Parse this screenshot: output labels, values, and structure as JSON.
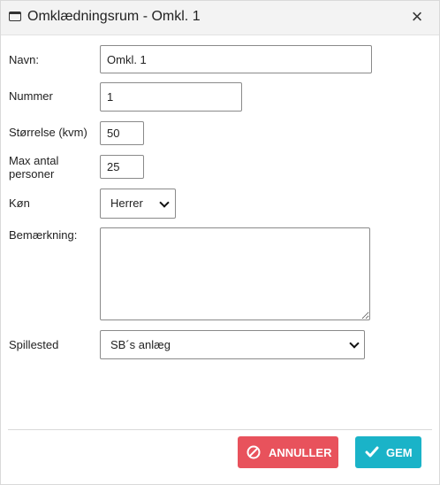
{
  "dialog": {
    "title": "Omklædningsrum - Omkl. 1",
    "close_glyph": "×",
    "window_icon": "window-icon"
  },
  "form": {
    "name": {
      "label": "Navn:",
      "value": "Omkl. 1"
    },
    "number": {
      "label": "Nummer",
      "value": "1"
    },
    "size": {
      "label": "Størrelse (kvm)",
      "value": "50"
    },
    "max_persons": {
      "label_line1": "Max antal",
      "label_line2": "personer",
      "value": "25"
    },
    "gender": {
      "label": "Køn",
      "selected": "Herrer"
    },
    "remark": {
      "label": "Bemærkning:",
      "value": ""
    },
    "venue": {
      "label": "Spillested",
      "selected": "SB´s anlæg"
    }
  },
  "buttons": {
    "cancel_label": "ANNULLER",
    "save_label": "GEM"
  },
  "colors": {
    "cancel_bg": "#e8525c",
    "save_bg": "#1ab3c8",
    "titlebar_bg": "#f3f3f3"
  }
}
